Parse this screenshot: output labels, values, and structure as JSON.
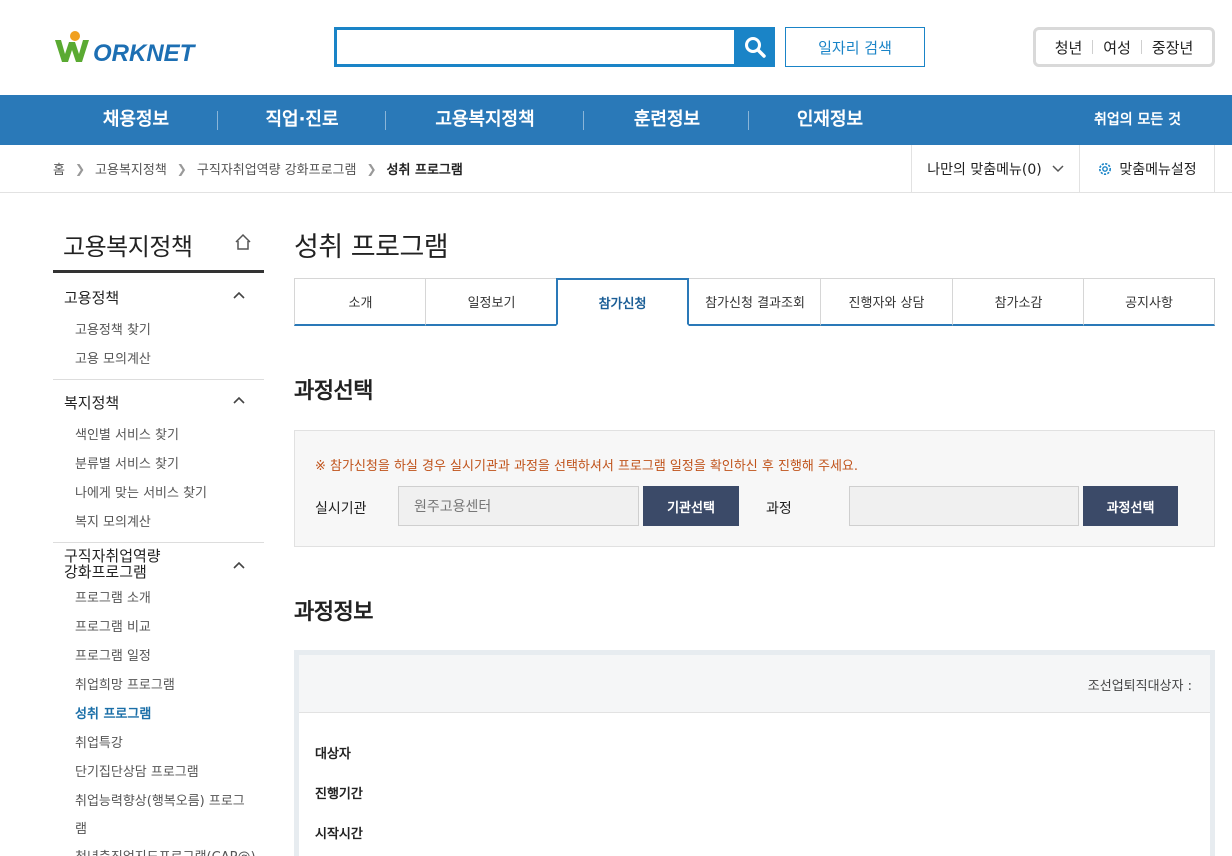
{
  "header": {
    "logo_text": "WORKNET",
    "search_placeholder": "",
    "job_search_label": "일자리 검색",
    "audience": [
      "청년",
      "여성",
      "중장년"
    ]
  },
  "gnb": {
    "items": [
      "채용정보",
      "직업·진로",
      "고용복지정책",
      "훈련정보",
      "인재정보"
    ],
    "right": "취업의 모든 것"
  },
  "breadcrumb": {
    "items": [
      "홈",
      "고용복지정책",
      "구직자취업역량 강화프로그램",
      "성취 프로그램"
    ]
  },
  "my_menu": {
    "label": "나만의 맞춤메뉴(0)",
    "settings": "맞춤메뉴설정"
  },
  "sidebar": {
    "title": "고용복지정책",
    "groups": [
      {
        "head": "고용정책",
        "items": [
          "고용정책 찾기",
          "고용 모의계산"
        ]
      },
      {
        "head": "복지정책",
        "items": [
          "색인별 서비스 찾기",
          "분류별 서비스 찾기",
          "나에게 맞는 서비스 찾기",
          "복지 모의계산"
        ]
      },
      {
        "head_line1": "구직자취업역량",
        "head_line2": "강화프로그램",
        "items": [
          "프로그램 소개",
          "프로그램 비교",
          "프로그램 일정",
          "취업희망 프로그램",
          "성취 프로그램",
          "취업특강",
          "단기집단상담 프로그램",
          "취업능력향상(행복오름) 프로그",
          "램",
          "청년층직업지도프로그램(CAP@)"
        ]
      }
    ],
    "active": "성취 프로그램"
  },
  "main": {
    "page_title": "성취 프로그램",
    "tabs": [
      "소개",
      "일정보기",
      "참가신청",
      "참가신청 결과조회",
      "진행자와 상담",
      "참가소감",
      "공지사항"
    ],
    "active_tab": "참가신청",
    "section1_title": "과정선택",
    "notice": "※ 참가신청을 하실 경우 실시기관과 과정을 선택하셔서 프로그램 일정을 확인하신 후 진행해 주세요.",
    "org_label": "실시기관",
    "org_value": "원주고용센터",
    "org_button": "기관선택",
    "course_label": "과정",
    "course_value": "",
    "course_button": "과정선택",
    "section2_title": "과정정보",
    "info_caption": "조선업퇴직대상자 :",
    "info_rows": [
      "대상자",
      "진행기간",
      "시작시간"
    ]
  },
  "colors": {
    "brand_blue": "#2a79b8",
    "search_blue": "#1a84c7",
    "dark_button": "#3b4a68",
    "notice_orange": "#c0531b"
  }
}
